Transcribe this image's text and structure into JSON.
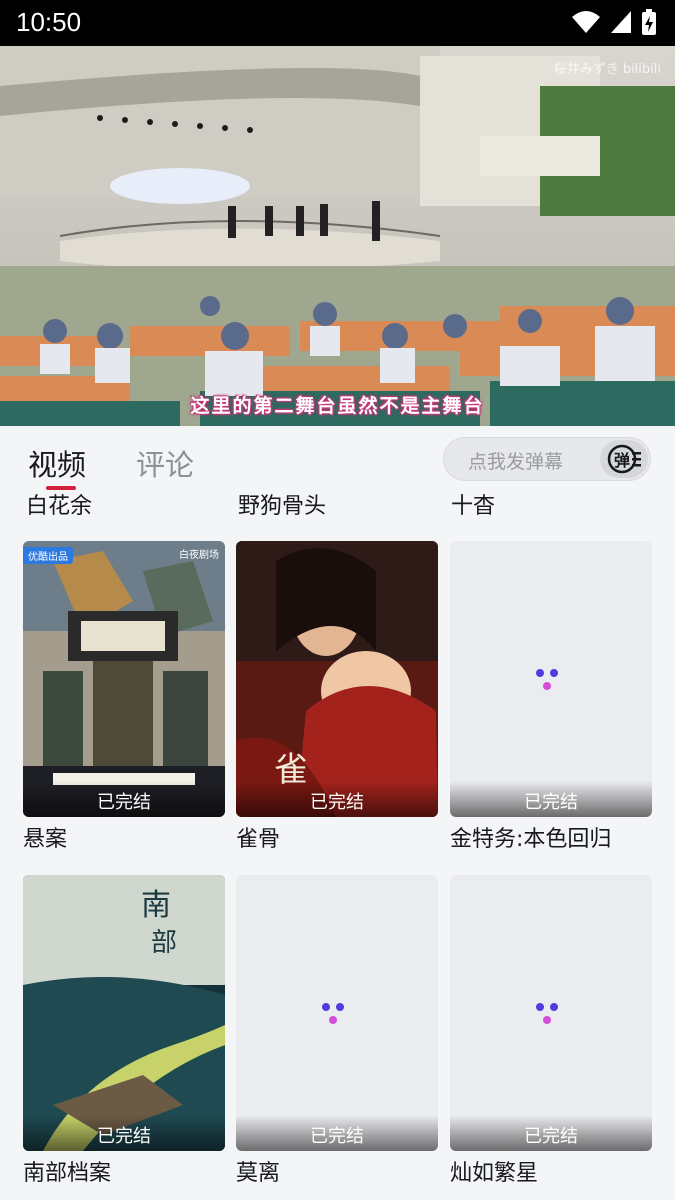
{
  "status_bar": {
    "time": "10:50"
  },
  "video": {
    "subtitle": "这里的第二舞台虽然不是主舞台",
    "watermark": "桜井みずき bilibili"
  },
  "tabs": [
    {
      "label": "视频"
    },
    {
      "label": "评论"
    }
  ],
  "danmaku": {
    "placeholder": "点我发弹幕",
    "button_label": "弹"
  },
  "partial_row": [
    "白花余",
    "野狗骨头",
    "十杳"
  ],
  "cards": [
    {
      "title": "悬案",
      "badge": "已完结",
      "source_tag": "优酷出品",
      "channel_tag": "白夜剧场"
    },
    {
      "title": "雀骨",
      "badge": "已完结"
    },
    {
      "title": "金特务:本色回归",
      "badge": "已完结"
    },
    {
      "title": "南部档案",
      "badge": "已完结"
    },
    {
      "title": "莫离",
      "badge": "已完结"
    },
    {
      "title": "灿如繁星",
      "badge": "已完结"
    }
  ],
  "colors": {
    "accent": "#d3203b",
    "loader_blue": "#4f3bdc",
    "loader_pink": "#d44cd8"
  }
}
